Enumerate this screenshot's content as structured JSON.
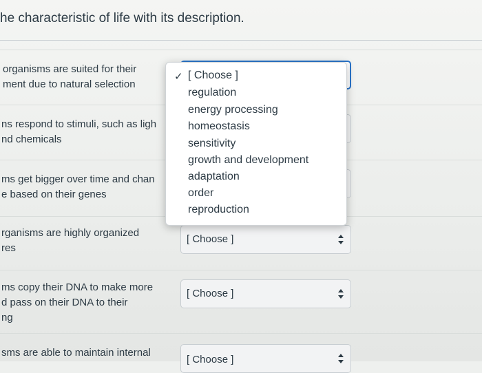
{
  "heading": "he characteristic of life with its description.",
  "questions": [
    {
      "line1": "organisms are suited for their",
      "line2": "ment due to natural selection",
      "line3": ""
    },
    {
      "line1": "ns respond to stimuli, such as ligh",
      "line2": "nd chemicals",
      "line3": ""
    },
    {
      "line1": "ms get bigger over time and chan",
      "line2": "e based on their genes",
      "line3": ""
    },
    {
      "line1": "rganisms are highly organized",
      "line2": "res",
      "line3": ""
    },
    {
      "line1": "ms copy their DNA to make more",
      "line2": "d pass on their DNA to their",
      "line3": "ng"
    },
    {
      "line1": "sms are able to maintain internal",
      "line2": "",
      "line3": ""
    }
  ],
  "selects": {
    "placeholder": "[ Choose ]",
    "s4": "[ Choose ]",
    "s5": "[ Choose ]",
    "s6": "[ Choose ]"
  },
  "dropdown": {
    "checkmark": "✓",
    "options": [
      "[ Choose ]",
      "regulation",
      "energy processing",
      "homeostasis",
      "sensitivity",
      "growth and development",
      "adaptation",
      "order",
      "reproduction"
    ]
  },
  "colors": {
    "focus_border": "#2a74c9",
    "text": "#2d3b45"
  }
}
